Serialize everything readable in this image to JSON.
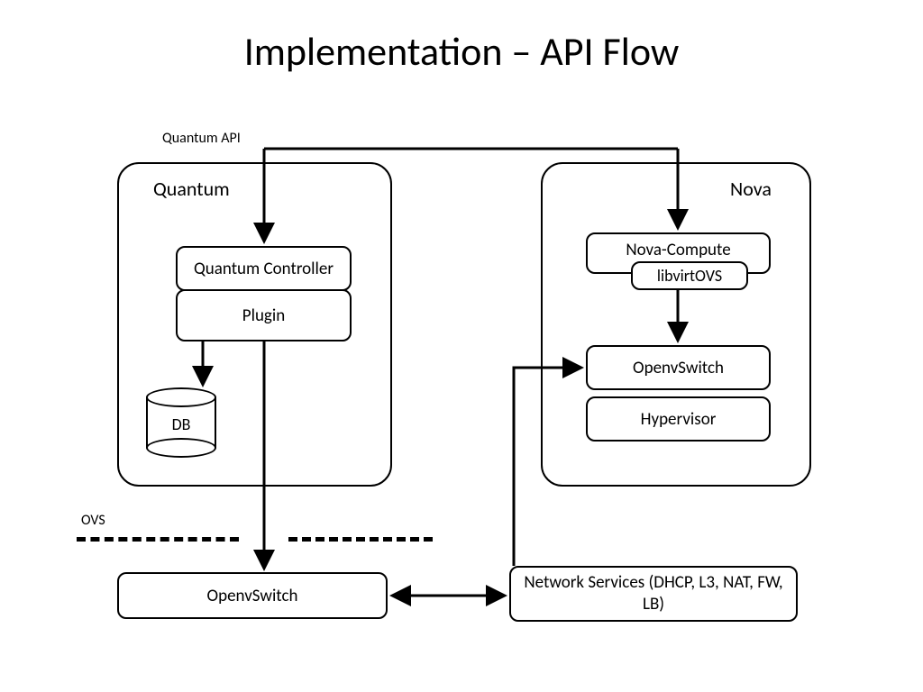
{
  "title": "Implementation – API Flow",
  "labels": {
    "quantum_api": "Quantum API",
    "ovs": "OVS"
  },
  "quantum": {
    "title": "Quantum",
    "controller": "Quantum Controller",
    "plugin": "Plugin",
    "db": "DB"
  },
  "nova": {
    "title": "Nova",
    "compute": "Nova-Compute",
    "libvirt": "libvirtOVS",
    "openvswitch": "OpenvSwitch",
    "hypervisor": "Hypervisor"
  },
  "bottom": {
    "openvswitch": "OpenvSwitch",
    "network_services": "Network Services (DHCP, L3, NAT, FW, LB)"
  }
}
